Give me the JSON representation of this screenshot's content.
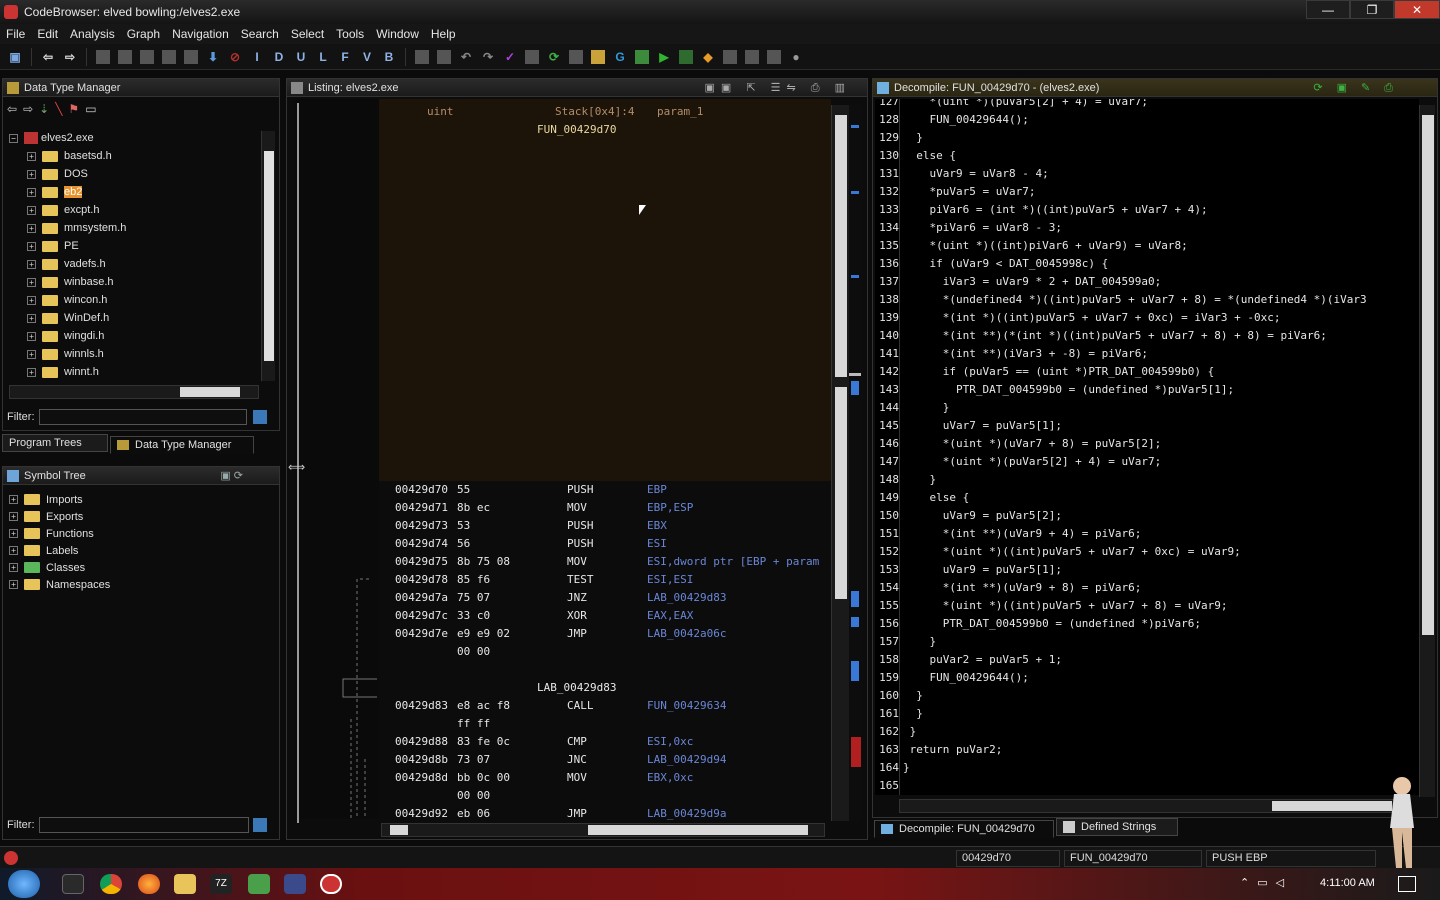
{
  "window": {
    "title": "CodeBrowser: elved bowling:/elves2.exe",
    "minimize": "—",
    "maximize": "❐",
    "close": "✕"
  },
  "menu": [
    "File",
    "Edit",
    "Analysis",
    "Graph",
    "Navigation",
    "Search",
    "Select",
    "Tools",
    "Window",
    "Help"
  ],
  "toolbar_letters": [
    "I",
    "D",
    "U",
    "L",
    "F",
    "V",
    "B"
  ],
  "dtm": {
    "title": "Data Type Manager",
    "root": "elves2.exe",
    "items": [
      "basetsd.h",
      "DOS",
      "eb2",
      "excpt.h",
      "mmsystem.h",
      "PE",
      "vadefs.h",
      "winbase.h",
      "wincon.h",
      "WinDef.h",
      "wingdi.h",
      "winnls.h",
      "winnt.h"
    ],
    "selected": "eb2",
    "filter_label": "Filter:"
  },
  "left_tabs": {
    "program_trees": "Program Trees",
    "data_type_manager": "Data Type Manager"
  },
  "symbol_tree": {
    "title": "Symbol Tree",
    "items": [
      "Imports",
      "Exports",
      "Functions",
      "Labels",
      "Classes",
      "Namespaces"
    ],
    "filter_label": "Filter:"
  },
  "listing": {
    "title": "Listing:  elves2.exe",
    "header": {
      "type": "uint",
      "storage": "Stack[0x4]:4",
      "param": "param_1",
      "func": "FUN_00429d70"
    },
    "rows": [
      {
        "addr": "00429d70",
        "bytes": "55",
        "mn": "PUSH",
        "op": "EBP"
      },
      {
        "addr": "00429d71",
        "bytes": "8b ec",
        "mn": "MOV",
        "op": "EBP,ESP"
      },
      {
        "addr": "00429d73",
        "bytes": "53",
        "mn": "PUSH",
        "op": "EBX"
      },
      {
        "addr": "00429d74",
        "bytes": "56",
        "mn": "PUSH",
        "op": "ESI"
      },
      {
        "addr": "00429d75",
        "bytes": "8b 75 08",
        "mn": "MOV",
        "op": "ESI,dword ptr [EBP + param"
      },
      {
        "addr": "00429d78",
        "bytes": "85 f6",
        "mn": "TEST",
        "op": "ESI,ESI"
      },
      {
        "addr": "00429d7a",
        "bytes": "75 07",
        "mn": "JNZ",
        "op": "LAB_00429d83"
      },
      {
        "addr": "00429d7c",
        "bytes": "33 c0",
        "mn": "XOR",
        "op": "EAX,EAX"
      },
      {
        "addr": "00429d7e",
        "bytes": "e9 e9 02",
        "mn": "JMP",
        "op": "LAB_0042a06c"
      },
      {
        "addr": "",
        "bytes": "00 00",
        "mn": "",
        "op": ""
      },
      {
        "addr": "",
        "bytes": "",
        "mn": "",
        "op": ""
      },
      {
        "label": "LAB_00429d83"
      },
      {
        "addr": "00429d83",
        "bytes": "e8 ac f8",
        "mn": "CALL",
        "op": "FUN_00429634"
      },
      {
        "addr": "",
        "bytes": "ff ff",
        "mn": "",
        "op": ""
      },
      {
        "addr": "00429d88",
        "bytes": "83 fe 0c",
        "mn": "CMP",
        "op": "ESI,0xc"
      },
      {
        "addr": "00429d8b",
        "bytes": "73 07",
        "mn": "JNC",
        "op": "LAB_00429d94"
      },
      {
        "addr": "00429d8d",
        "bytes": "bb 0c 00",
        "mn": "MOV",
        "op": "EBX,0xc"
      },
      {
        "addr": "",
        "bytes": "00 00",
        "mn": "",
        "op": ""
      },
      {
        "addr": "00429d92",
        "bytes": "eb 06",
        "mn": "JMP",
        "op": "LAB_00429d9a"
      }
    ]
  },
  "decompile": {
    "title": "Decompile: FUN_00429d70 -  (elves2.exe)",
    "lines": [
      {
        "n": "127",
        "t": "    *(uint *)(puVar5[2] + 4) = uVar7;"
      },
      {
        "n": "128",
        "t": "    FUN_00429644();"
      },
      {
        "n": "129",
        "t": "  }"
      },
      {
        "n": "130",
        "t": "  else {"
      },
      {
        "n": "131",
        "t": "    uVar9 = uVar8 - 4;"
      },
      {
        "n": "132",
        "t": "    *puVar5 = uVar7;"
      },
      {
        "n": "133",
        "t": "    piVar6 = (int *)((int)puVar5 + uVar7 + 4);"
      },
      {
        "n": "134",
        "t": "    *piVar6 = uVar8 - 3;"
      },
      {
        "n": "135",
        "t": "    *(uint *)((int)piVar6 + uVar9) = uVar8;"
      },
      {
        "n": "136",
        "t": "    if (uVar9 < DAT_0045998c) {"
      },
      {
        "n": "137",
        "t": "      iVar3 = uVar9 * 2 + DAT_004599a0;"
      },
      {
        "n": "138",
        "t": "      *(undefined4 *)((int)puVar5 + uVar7 + 8) = *(undefined4 *)(iVar3"
      },
      {
        "n": "139",
        "t": "      *(int *)((int)puVar5 + uVar7 + 0xc) = iVar3 + -0xc;"
      },
      {
        "n": "140",
        "t": "      *(int **)(*(int *)((int)puVar5 + uVar7 + 8) + 8) = piVar6;"
      },
      {
        "n": "141",
        "t": "      *(int **)(iVar3 + -8) = piVar6;"
      },
      {
        "n": "142",
        "t": "      if (puVar5 == (uint *)PTR_DAT_004599b0) {"
      },
      {
        "n": "143",
        "t": "        PTR_DAT_004599b0 = (undefined *)puVar5[1];"
      },
      {
        "n": "144",
        "t": "      }"
      },
      {
        "n": "145",
        "t": "      uVar7 = puVar5[1];"
      },
      {
        "n": "146",
        "t": "      *(uint *)(uVar7 + 8) = puVar5[2];"
      },
      {
        "n": "147",
        "t": "      *(uint *)(puVar5[2] + 4) = uVar7;"
      },
      {
        "n": "148",
        "t": "    }"
      },
      {
        "n": "149",
        "t": "    else {"
      },
      {
        "n": "150",
        "t": "      uVar9 = puVar5[2];"
      },
      {
        "n": "151",
        "t": "      *(int **)(uVar9 + 4) = piVar6;"
      },
      {
        "n": "152",
        "t": "      *(uint *)((int)puVar5 + uVar7 + 0xc) = uVar9;"
      },
      {
        "n": "153",
        "t": "      uVar9 = puVar5[1];"
      },
      {
        "n": "154",
        "t": "      *(int **)(uVar9 + 8) = piVar6;"
      },
      {
        "n": "155",
        "t": "      *(uint *)((int)puVar5 + uVar7 + 8) = uVar9;"
      },
      {
        "n": "156",
        "t": "      PTR_DAT_004599b0 = (undefined *)piVar6;"
      },
      {
        "n": "157",
        "t": "    }"
      },
      {
        "n": "158",
        "t": "    puVar2 = puVar5 + 1;"
      },
      {
        "n": "159",
        "t": "    FUN_00429644();"
      },
      {
        "n": "160",
        "t": "  }"
      },
      {
        "n": "161",
        "t": "  }"
      },
      {
        "n": "162",
        "t": " }"
      },
      {
        "n": "163",
        "t": " return puVar2;"
      },
      {
        "n": "164",
        "t": "}"
      },
      {
        "n": "165",
        "t": ""
      }
    ]
  },
  "right_tabs": {
    "decompile": "Decompile: FUN_00429d70",
    "defined_strings": "Defined Strings"
  },
  "status": {
    "addr": "00429d70",
    "func": "FUN_00429d70",
    "instr": "PUSH EBP"
  },
  "taskbar": {
    "time": "4:11:00 AM"
  },
  "colors": {
    "listing_bg": "#1c1408",
    "operand_blue": "#6a86d6",
    "selection_orange": "#e8922c",
    "close_red": "#c0392b"
  }
}
